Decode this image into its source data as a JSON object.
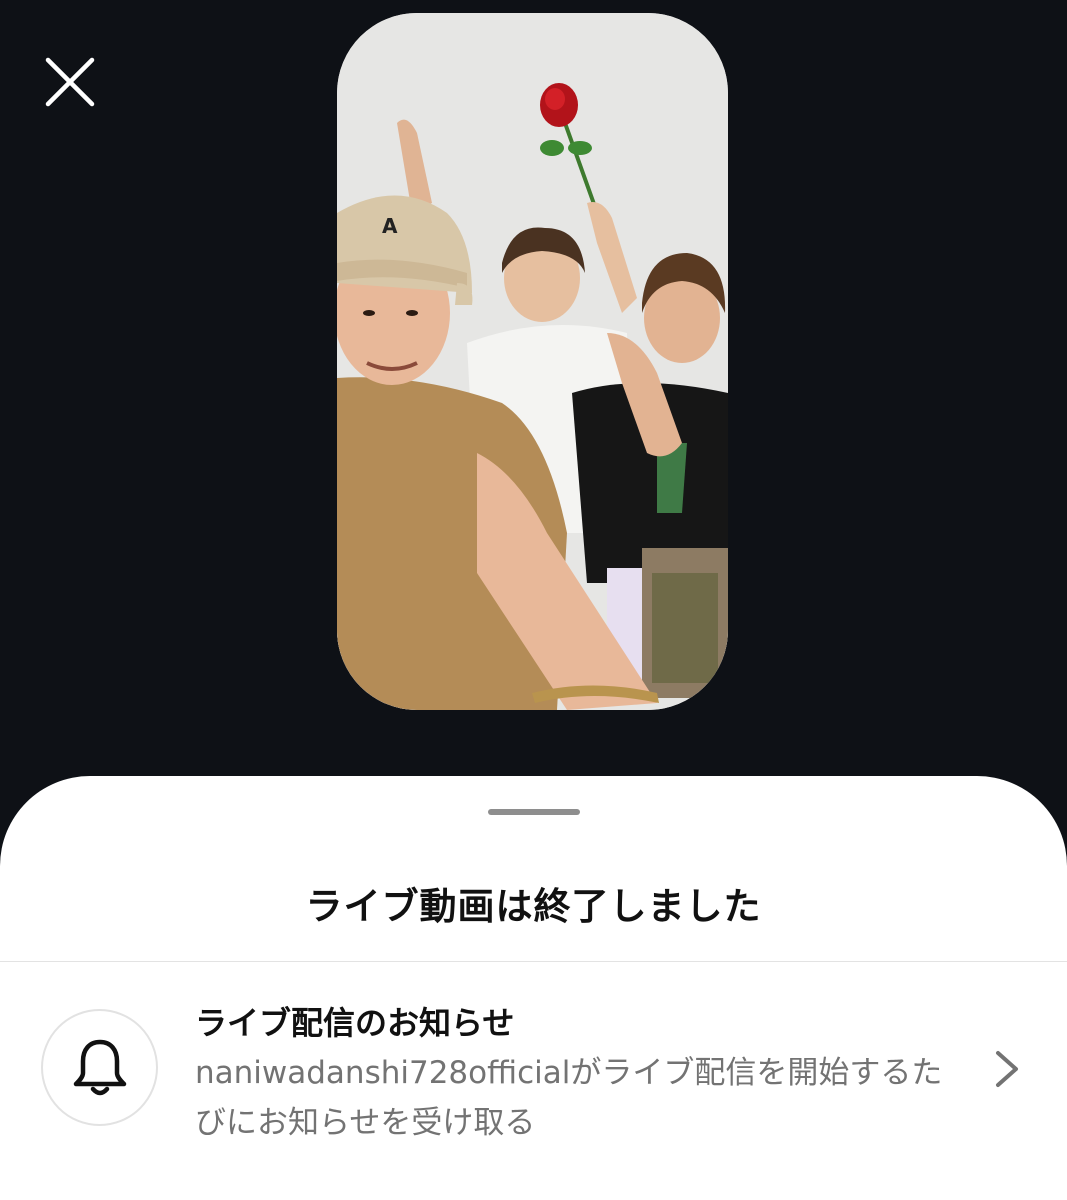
{
  "app": {
    "background_color": "#0e1116",
    "sheet_color": "#ffffff"
  },
  "close_button": {
    "icon": "close-icon"
  },
  "video_preview": {
    "icon": "live-video-thumbnail"
  },
  "sheet": {
    "title": "ライブ動画は終了しました"
  },
  "notification_option": {
    "icon": "bell-icon",
    "title": "ライブ配信のお知らせ",
    "description": "naniwadanshi728officialがライブ配信を開始するたびにお知らせを受け取る",
    "chevron_icon": "chevron-right-icon"
  }
}
